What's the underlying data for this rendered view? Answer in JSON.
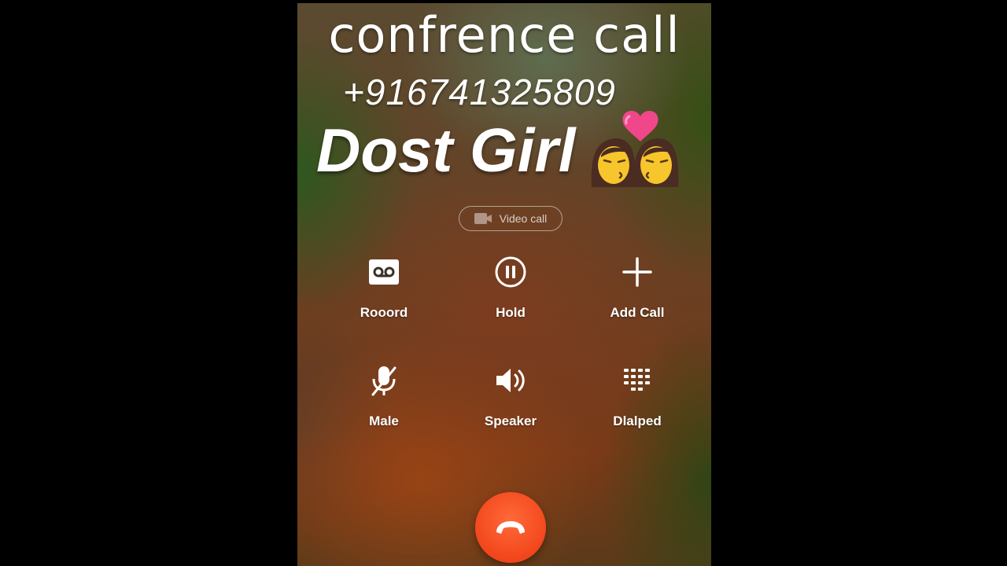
{
  "overlay": {
    "title": "confrence call",
    "number": "+916741325809",
    "name": "Dost Girl",
    "emoji": "couple-kissing-women-emoji"
  },
  "call_screen": {
    "video_call_label": "Video call",
    "controls": [
      {
        "label": "Rooord",
        "icon": "record-icon"
      },
      {
        "label": "Hold",
        "icon": "pause-icon"
      },
      {
        "label": "Add Call",
        "icon": "plus-icon"
      },
      {
        "label": "Male",
        "icon": "mute-mic-icon"
      },
      {
        "label": "Speaker",
        "icon": "speaker-icon"
      },
      {
        "label": "Dlalped",
        "icon": "dialpad-icon"
      }
    ],
    "end_call_icon": "end-call-icon",
    "end_call_color": "#f2461c"
  }
}
